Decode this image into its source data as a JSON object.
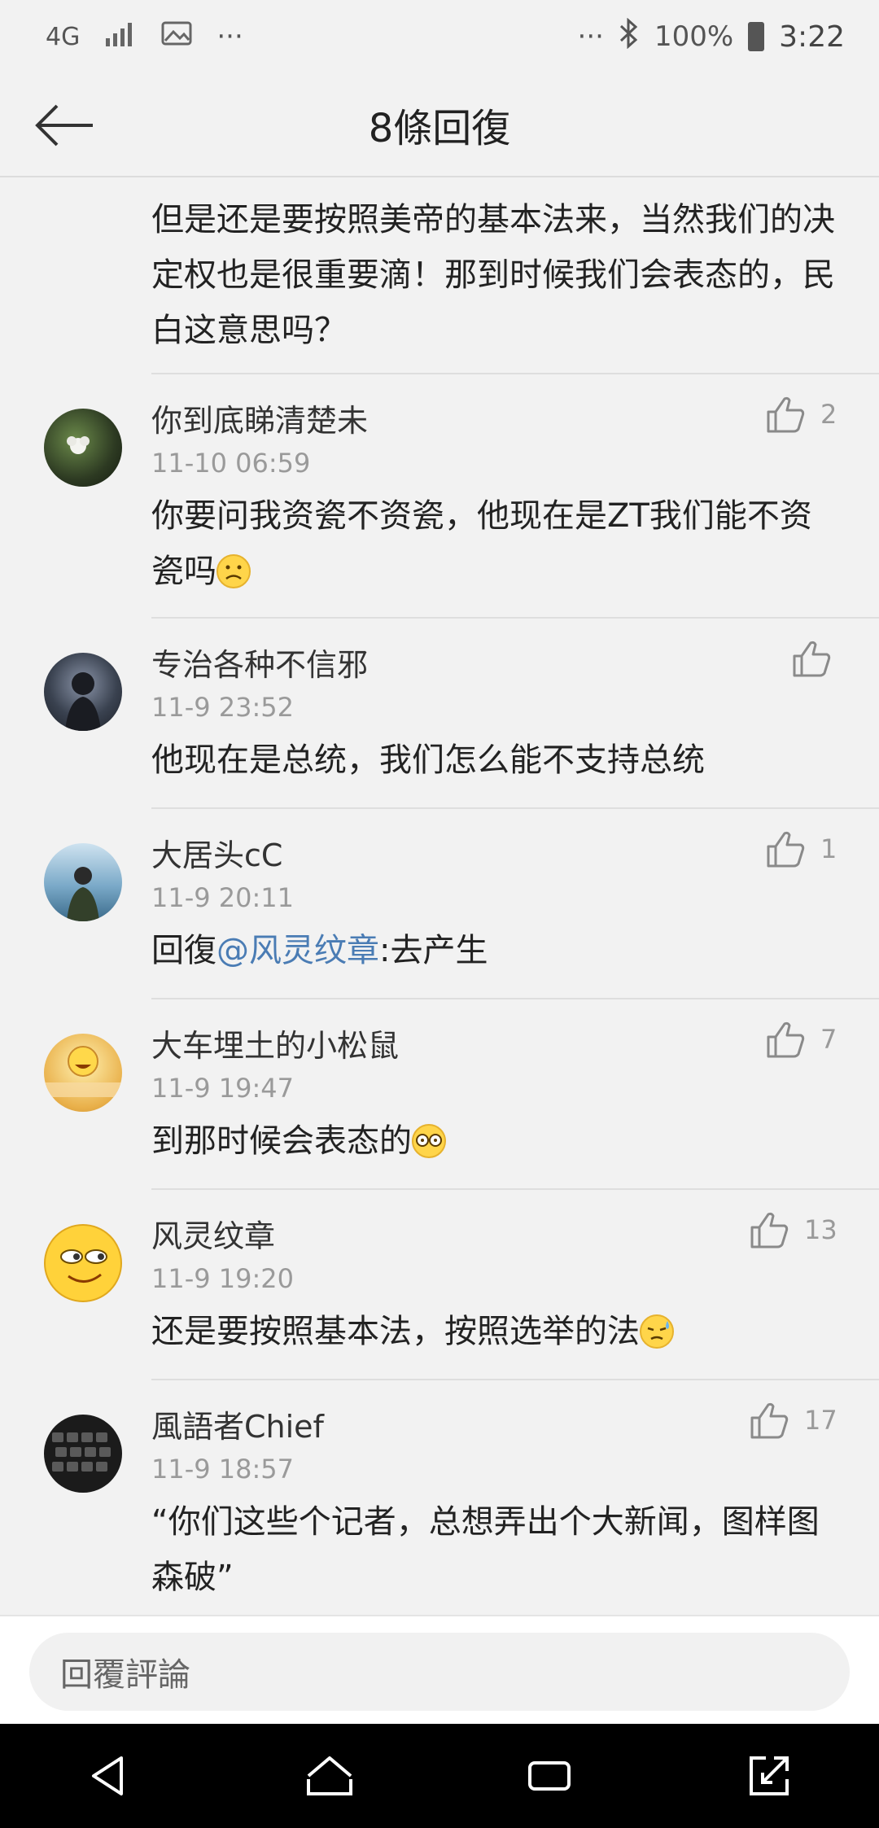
{
  "status_bar": {
    "network": "4G",
    "more_left": "···",
    "more_right": "···",
    "battery": "100%",
    "time": "3:22"
  },
  "header": {
    "title": "8條回復"
  },
  "first_comment_tail": {
    "text": "但是还是要按照美帝的基本法来，当然我们的决定权也是很重要滴！那到时候我们会表态的，民白这意思吗？"
  },
  "comments": [
    {
      "username": "你到底睇清楚未",
      "time": "11-10 06:59",
      "text": "你要问我资瓷不资瓷，他现在是ZT我们能不资瓷吗",
      "emoji": "frowning-emoji",
      "likes": "2",
      "avatar_color": "#2d3a22"
    },
    {
      "username": "专治各种不信邪",
      "time": "11-9 23:52",
      "text": "他现在是总统，我们怎么能不支持总统",
      "likes": "",
      "avatar_color": "#3a4250"
    },
    {
      "username": "大居头cC",
      "time": "11-9 20:11",
      "reply_prefix": "回復",
      "mention": "@风灵纹章",
      "reply_rest": ":去产生",
      "likes": "1",
      "avatar_color": "#7aa9c8"
    },
    {
      "username": "大车埋土的小松鼠",
      "time": "11-9 19:47",
      "text": "到那时候会表态的",
      "emoji": "dizzy-glasses-emoji",
      "likes": "7",
      "avatar_color": "#e9b04a"
    },
    {
      "username": "风灵纹章",
      "time": "11-9 19:20",
      "text": "还是要按照基本法，按照选举的法",
      "emoji": "sweat-emoji",
      "likes": "13",
      "avatar_color": "#ffd23a"
    },
    {
      "username": "風語者Chief",
      "time": "11-9 18:57",
      "text": "“你们这些个记者，总想弄出个大新闻，图样图森破”",
      "likes": "17",
      "avatar_color": "#1b1b1b"
    }
  ],
  "reply_bar": {
    "placeholder": "回覆評論"
  },
  "colors": {
    "background": "#f2f2f2",
    "mention": "#4a7cb4",
    "muted": "#9a9a9a"
  }
}
